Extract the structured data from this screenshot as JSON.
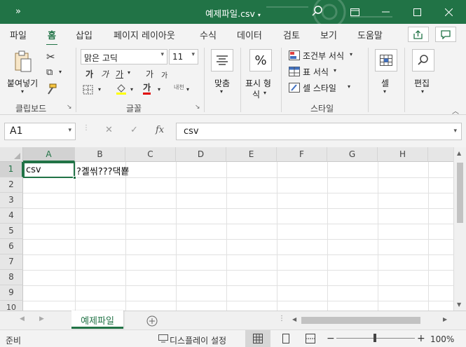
{
  "title_bar": {
    "qat": "»",
    "filename": "예제파일.csv",
    "caret": "▾",
    "colors": {
      "bg": "#217346",
      "fg": "#ffffff"
    }
  },
  "ribbon_tabs": [
    "파일",
    "홈",
    "삽입",
    "페이지 레이아웃",
    "수식",
    "데이터",
    "검토",
    "보기",
    "도움말"
  ],
  "active_tab": "홈",
  "clipboard": {
    "paste_label": "붙여넣기",
    "group_label": "클립보드"
  },
  "font": {
    "name": "맑은 고딕",
    "size": "11",
    "bold": "가",
    "italic": "가",
    "underline": "가",
    "grow": "가",
    "shrink": "가",
    "fontcolor": "가",
    "phonetic": "내천",
    "group_label": "글꼴"
  },
  "alignment": {
    "label": "맞춤"
  },
  "number": {
    "label_line1": "표시 형",
    "label_line2": "식"
  },
  "styles": {
    "conditional": "조건부 서식",
    "table": "표 서식",
    "cell_style": "셀 스타일",
    "group_label": "스타일"
  },
  "cells_group": {
    "label": "셀"
  },
  "editing": {
    "label": "편집"
  },
  "formula_bar": {
    "name_box": "A1",
    "fx": "fx",
    "value": "csv"
  },
  "columns": [
    "A",
    "B",
    "C",
    "D",
    "E",
    "F",
    "G",
    "H"
  ],
  "rows": [
    "1",
    "2",
    "3",
    "4",
    "5",
    "6",
    "7",
    "8",
    "9",
    "10"
  ],
  "cells": {
    "A1": "csv",
    "B1": "?곌씪???댁뿉"
  },
  "sheet_tabs": [
    "예제파일"
  ],
  "status": {
    "ready": "준비",
    "display_settings": "디스플레이 설정",
    "zoom": "100%"
  },
  "accent_color": "#217346"
}
